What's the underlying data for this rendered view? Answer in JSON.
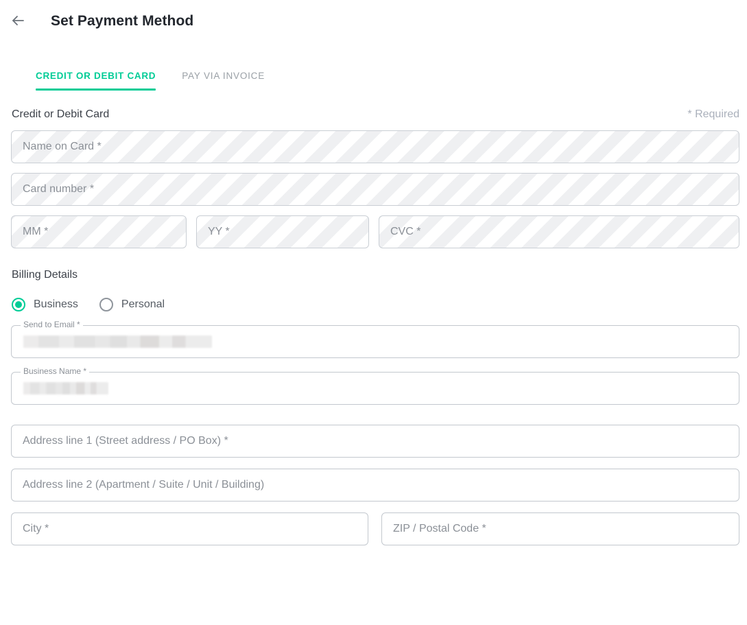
{
  "header": {
    "back_icon": "arrow-left-icon",
    "title": "Set Payment Method"
  },
  "tabs": [
    {
      "label": "CREDIT OR DEBIT CARD",
      "active": true
    },
    {
      "label": "PAY VIA INVOICE",
      "active": false
    }
  ],
  "card_section": {
    "label": "Credit or Debit Card",
    "required_note": "* Required",
    "fields": {
      "name_on_card": "Name on Card *",
      "card_number": "Card number *",
      "expiry_month": "MM *",
      "expiry_year": "YY *",
      "cvc": "CVC *"
    }
  },
  "billing": {
    "title": "Billing Details",
    "options": [
      {
        "label": "Business",
        "selected": true
      },
      {
        "label": "Personal",
        "selected": false
      }
    ],
    "send_to_email": {
      "label": "Send to Email *",
      "value": ""
    },
    "business_name": {
      "label": "Business Name *",
      "value": ""
    },
    "address_line_1": "Address line 1 (Street address / PO Box) *",
    "address_line_2": "Address line 2 (Apartment / Suite / Unit / Building)",
    "city": "City *",
    "zip": "ZIP / Postal Code *"
  },
  "colors": {
    "accent": "#00cc96",
    "text": "#3c4149",
    "placeholder": "#8b9097",
    "border": "#c3c8ce",
    "muted": "#aab0bb"
  }
}
